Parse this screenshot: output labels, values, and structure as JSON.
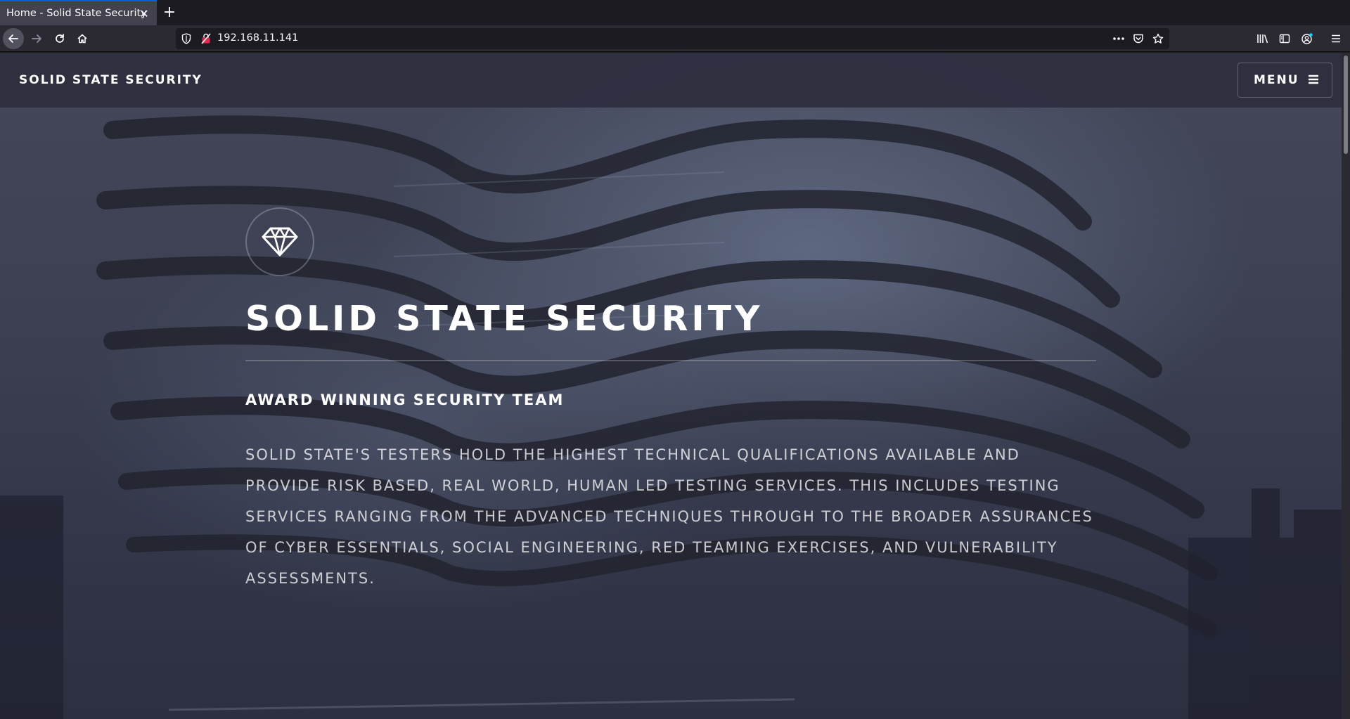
{
  "browser": {
    "tab_title": "Home - Solid State Security",
    "tab_close": "✕",
    "new_tab": "+",
    "url": "192.168.11.141",
    "accent": "#0060df"
  },
  "site": {
    "logo": "SOLID STATE SECURITY",
    "menu_label": "MENU",
    "menu_icon": "hamburger-icon",
    "emblem_icon": "diamond-icon"
  },
  "banner": {
    "title": "SOLID STATE SECURITY",
    "subtitle": "AWARD WINNING SECURITY TEAM",
    "body": "Solid State's testers hold the highest technical qualifications available and provide risk based, real world, human led testing services. This includes testing services ranging from the advanced techniques through to the broader assurances of Cyber Essentials, Social Engineering, Red Teaming Exercises, and Vulnerability Assessments."
  }
}
